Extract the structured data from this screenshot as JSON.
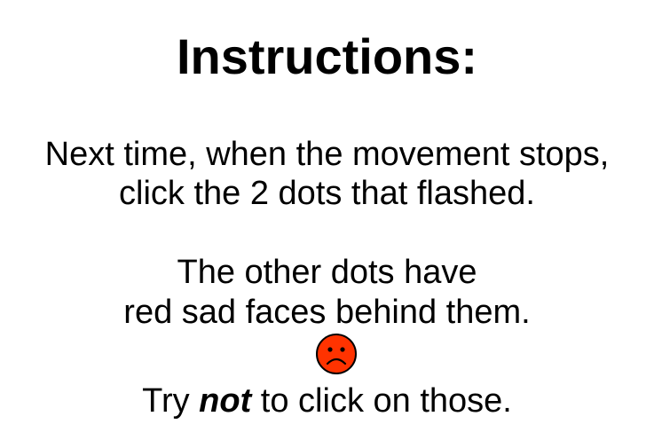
{
  "instructions": {
    "title": "Instructions:",
    "line1": "Next time, when the movement stops,",
    "line2": "click the 2 dots that flashed.",
    "line3": "The other dots have",
    "line4": "red sad faces behind them.",
    "line5_prefix": "Try ",
    "line5_emphasis": "not",
    "line5_suffix": " to click on those.",
    "icon": "sad-face-icon",
    "colors": {
      "text": "#000000",
      "face_fill": "#ff3300",
      "face_outline": "#000000",
      "background": "#ffffff"
    }
  }
}
